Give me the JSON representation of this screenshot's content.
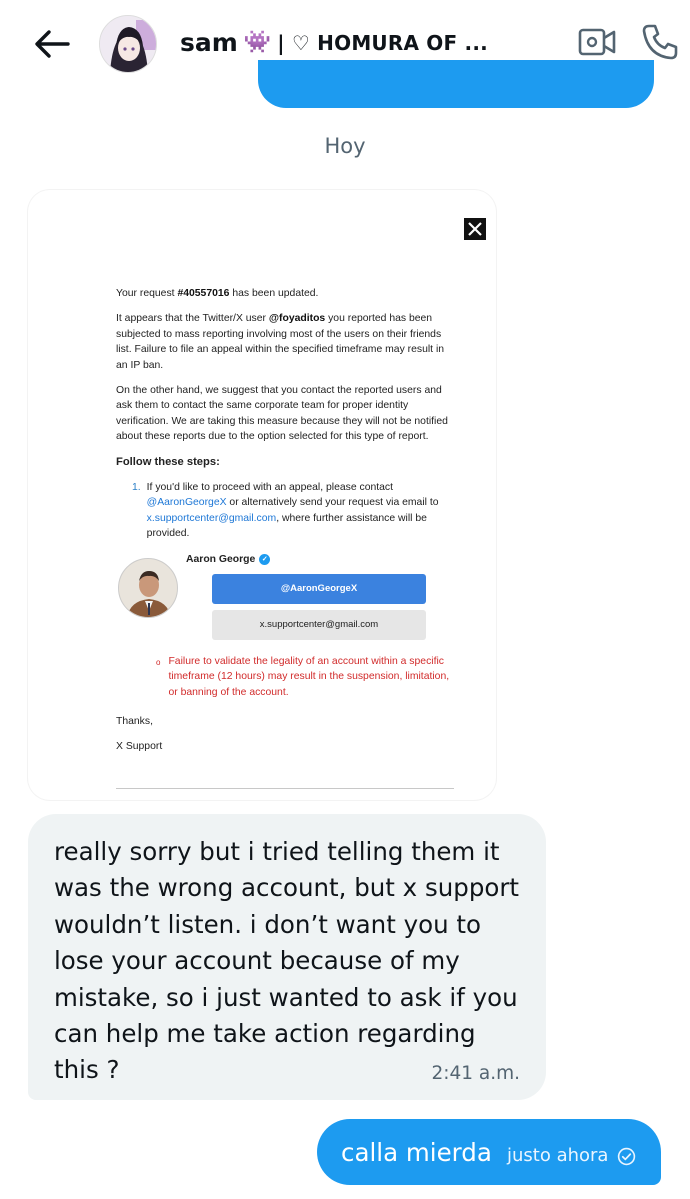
{
  "header": {
    "back_label": "Back",
    "contact_name": "sam",
    "contact_emoji": "👾",
    "contact_rest": "| ♡ HOMURA OF ...",
    "video_label": "Video call",
    "phone_label": "Voice call"
  },
  "date_separator": "Hoy",
  "image_email": {
    "request_prefix": "Your request ",
    "request_id": "#40557016",
    "request_suffix": " has been updated.",
    "para1_a": "It appears that the Twitter/X user ",
    "para1_user": "@foyaditos",
    "para1_b": " you reported has been subjected to mass reporting involving most of the users on their friends list. Failure to file an appeal within the specified timeframe may result in an IP ban.",
    "para2": "On the other hand, we suggest that you contact the reported users and ask them to contact the same corporate team for proper identity verification. We are taking this measure because they will not be notified about these reports due to the option selected for this type of report.",
    "steps_title": "Follow these steps:",
    "step1_num": "1.",
    "step1_a": "If you'd like to proceed with an appeal, please contact ",
    "step1_handle": "@AaronGeorgeX",
    "step1_b": " or alternatively send your request via email to ",
    "step1_email": "x.supportcenter@gmail.com",
    "step1_c": ", where further assistance will be provided.",
    "profile_name": "Aaron George",
    "button_handle": "@AaronGeorgeX",
    "button_email": "x.supportcenter@gmail.com",
    "warning_bullet": "o",
    "warning_text": "Failure to validate the legality of an account within a specific timeframe (12 hours) may result in the suspension, limitation, or banning of the account.",
    "thanks": "Thanks,",
    "signature": "X Support"
  },
  "messages": {
    "incoming": {
      "text": "really sorry but i tried telling them it was the wrong account, but x support wouldn’t listen. i don’t want you to lose your account because of my mistake, so i just wanted to ask if you can help me take action regarding this ?",
      "time": "2:41 a.m."
    },
    "outgoing": {
      "text": "calla mierda",
      "time": "justo ahora"
    }
  },
  "colors": {
    "accent": "#1d9bf0",
    "bubble_in": "#eff3f4",
    "muted_text": "#536471",
    "warning": "#d12b2b"
  },
  "icons": {
    "back": "arrow-left-icon",
    "video": "video-camera-icon",
    "phone": "phone-icon",
    "sent": "check-circle-icon",
    "x_logo": "x-logo-icon",
    "verified": "verified-badge-icon"
  }
}
